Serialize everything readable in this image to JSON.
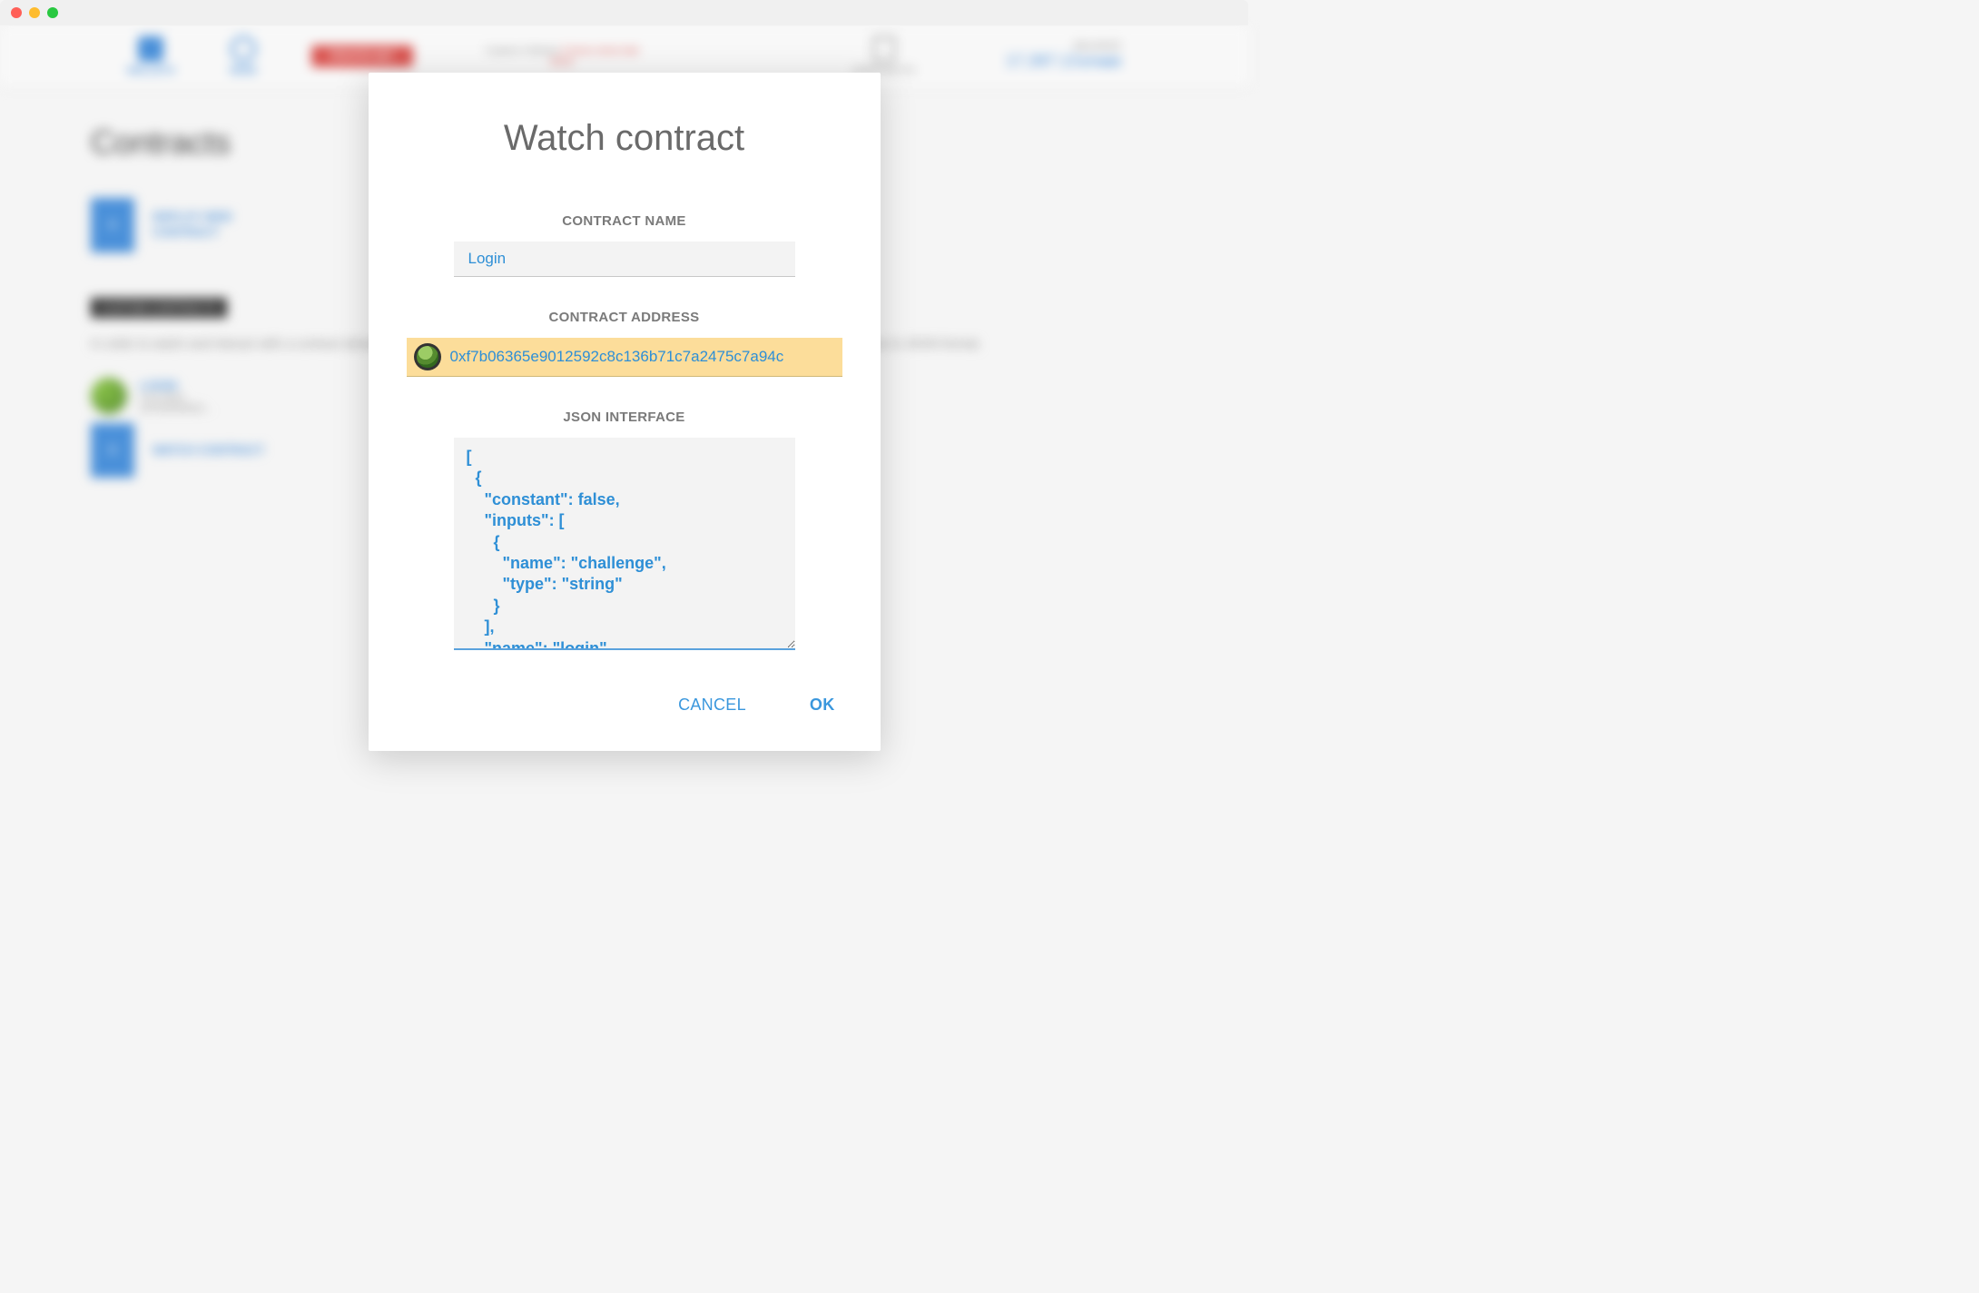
{
  "bg": {
    "nav": {
      "wallets": "WALLETS",
      "send": "SEND"
    },
    "redBtn": "PRIVATE-NET",
    "status_pre": "0 peers   0 blocks   ",
    "status_red": "0 hours since last",
    "status_sub": "block",
    "contracts": "CONTRACTS",
    "balance_label": "BALANCE",
    "balance_value": "17,397.13",
    "balance_unit": "ETHER",
    "page_title": "Contracts",
    "deploy": "DEPLOY NEW CONTRACT",
    "custom_badge": "CUSTOM CONTRACTS",
    "para": "In order to watch and interact with a contract already deployed on the blockchain, you need to know its address and description of its interface in JSON format.",
    "item_name": "LOGIN",
    "item_bal": "0.00 ether",
    "item_addr": "0xf7b06365e9…",
    "watch": "WATCH CONTRACT"
  },
  "modal": {
    "title": "Watch contract",
    "name_label": "CONTRACT NAME",
    "name_value": "Login",
    "addr_label": "CONTRACT ADDRESS",
    "addr_value": "0xf7b06365e9012592c8c136b71c7a2475c7a94c",
    "json_label": "JSON INTERFACE",
    "json_value": "[\n  {\n    \"constant\": false,\n    \"inputs\": [\n      {\n        \"name\": \"challenge\",\n        \"type\": \"string\"\n      }\n    ],\n    \"name\": \"login\",",
    "cancel": "CANCEL",
    "ok": "OK"
  }
}
